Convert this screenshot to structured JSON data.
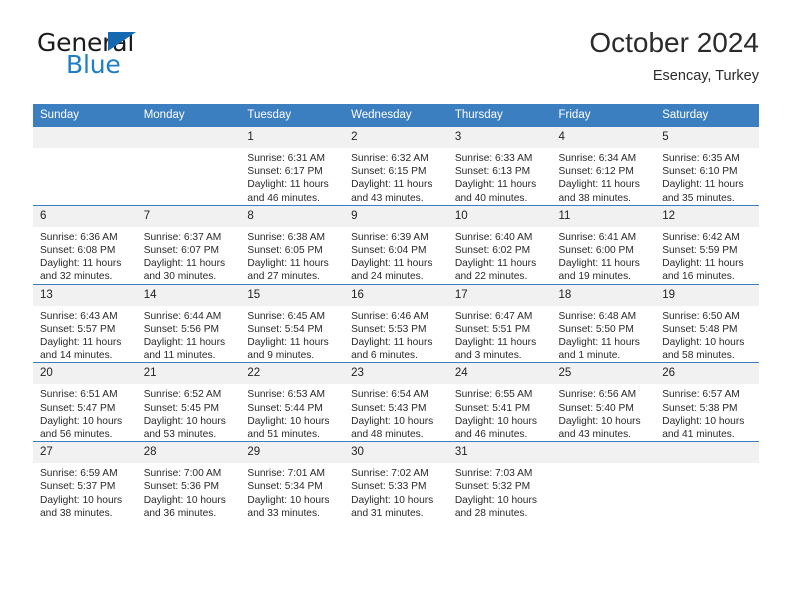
{
  "brand": {
    "name_part1": "General",
    "name_part2": "Blue",
    "triangle_color": "#1569b0",
    "blue_color": "#1f7ec4"
  },
  "header": {
    "title": "October 2024",
    "location": "Esencay, Turkey"
  },
  "theme": {
    "header_blue": "#3c7fc1",
    "daynum_band": "#f1f1f1",
    "text": "#222222"
  },
  "weekdays": [
    "Sunday",
    "Monday",
    "Tuesday",
    "Wednesday",
    "Thursday",
    "Friday",
    "Saturday"
  ],
  "weeks": [
    [
      {
        "day": "",
        "blank": true
      },
      {
        "day": "",
        "blank": true
      },
      {
        "day": "1",
        "sunrise": "Sunrise: 6:31 AM",
        "sunset": "Sunset: 6:17 PM",
        "daylight1": "Daylight: 11 hours",
        "daylight2": "and 46 minutes."
      },
      {
        "day": "2",
        "sunrise": "Sunrise: 6:32 AM",
        "sunset": "Sunset: 6:15 PM",
        "daylight1": "Daylight: 11 hours",
        "daylight2": "and 43 minutes."
      },
      {
        "day": "3",
        "sunrise": "Sunrise: 6:33 AM",
        "sunset": "Sunset: 6:13 PM",
        "daylight1": "Daylight: 11 hours",
        "daylight2": "and 40 minutes."
      },
      {
        "day": "4",
        "sunrise": "Sunrise: 6:34 AM",
        "sunset": "Sunset: 6:12 PM",
        "daylight1": "Daylight: 11 hours",
        "daylight2": "and 38 minutes."
      },
      {
        "day": "5",
        "sunrise": "Sunrise: 6:35 AM",
        "sunset": "Sunset: 6:10 PM",
        "daylight1": "Daylight: 11 hours",
        "daylight2": "and 35 minutes."
      }
    ],
    [
      {
        "day": "6",
        "sunrise": "Sunrise: 6:36 AM",
        "sunset": "Sunset: 6:08 PM",
        "daylight1": "Daylight: 11 hours",
        "daylight2": "and 32 minutes."
      },
      {
        "day": "7",
        "sunrise": "Sunrise: 6:37 AM",
        "sunset": "Sunset: 6:07 PM",
        "daylight1": "Daylight: 11 hours",
        "daylight2": "and 30 minutes."
      },
      {
        "day": "8",
        "sunrise": "Sunrise: 6:38 AM",
        "sunset": "Sunset: 6:05 PM",
        "daylight1": "Daylight: 11 hours",
        "daylight2": "and 27 minutes."
      },
      {
        "day": "9",
        "sunrise": "Sunrise: 6:39 AM",
        "sunset": "Sunset: 6:04 PM",
        "daylight1": "Daylight: 11 hours",
        "daylight2": "and 24 minutes."
      },
      {
        "day": "10",
        "sunrise": "Sunrise: 6:40 AM",
        "sunset": "Sunset: 6:02 PM",
        "daylight1": "Daylight: 11 hours",
        "daylight2": "and 22 minutes."
      },
      {
        "day": "11",
        "sunrise": "Sunrise: 6:41 AM",
        "sunset": "Sunset: 6:00 PM",
        "daylight1": "Daylight: 11 hours",
        "daylight2": "and 19 minutes."
      },
      {
        "day": "12",
        "sunrise": "Sunrise: 6:42 AM",
        "sunset": "Sunset: 5:59 PM",
        "daylight1": "Daylight: 11 hours",
        "daylight2": "and 16 minutes."
      }
    ],
    [
      {
        "day": "13",
        "sunrise": "Sunrise: 6:43 AM",
        "sunset": "Sunset: 5:57 PM",
        "daylight1": "Daylight: 11 hours",
        "daylight2": "and 14 minutes."
      },
      {
        "day": "14",
        "sunrise": "Sunrise: 6:44 AM",
        "sunset": "Sunset: 5:56 PM",
        "daylight1": "Daylight: 11 hours",
        "daylight2": "and 11 minutes."
      },
      {
        "day": "15",
        "sunrise": "Sunrise: 6:45 AM",
        "sunset": "Sunset: 5:54 PM",
        "daylight1": "Daylight: 11 hours",
        "daylight2": "and 9 minutes."
      },
      {
        "day": "16",
        "sunrise": "Sunrise: 6:46 AM",
        "sunset": "Sunset: 5:53 PM",
        "daylight1": "Daylight: 11 hours",
        "daylight2": "and 6 minutes."
      },
      {
        "day": "17",
        "sunrise": "Sunrise: 6:47 AM",
        "sunset": "Sunset: 5:51 PM",
        "daylight1": "Daylight: 11 hours",
        "daylight2": "and 3 minutes."
      },
      {
        "day": "18",
        "sunrise": "Sunrise: 6:48 AM",
        "sunset": "Sunset: 5:50 PM",
        "daylight1": "Daylight: 11 hours",
        "daylight2": "and 1 minute."
      },
      {
        "day": "19",
        "sunrise": "Sunrise: 6:50 AM",
        "sunset": "Sunset: 5:48 PM",
        "daylight1": "Daylight: 10 hours",
        "daylight2": "and 58 minutes."
      }
    ],
    [
      {
        "day": "20",
        "sunrise": "Sunrise: 6:51 AM",
        "sunset": "Sunset: 5:47 PM",
        "daylight1": "Daylight: 10 hours",
        "daylight2": "and 56 minutes."
      },
      {
        "day": "21",
        "sunrise": "Sunrise: 6:52 AM",
        "sunset": "Sunset: 5:45 PM",
        "daylight1": "Daylight: 10 hours",
        "daylight2": "and 53 minutes."
      },
      {
        "day": "22",
        "sunrise": "Sunrise: 6:53 AM",
        "sunset": "Sunset: 5:44 PM",
        "daylight1": "Daylight: 10 hours",
        "daylight2": "and 51 minutes."
      },
      {
        "day": "23",
        "sunrise": "Sunrise: 6:54 AM",
        "sunset": "Sunset: 5:43 PM",
        "daylight1": "Daylight: 10 hours",
        "daylight2": "and 48 minutes."
      },
      {
        "day": "24",
        "sunrise": "Sunrise: 6:55 AM",
        "sunset": "Sunset: 5:41 PM",
        "daylight1": "Daylight: 10 hours",
        "daylight2": "and 46 minutes."
      },
      {
        "day": "25",
        "sunrise": "Sunrise: 6:56 AM",
        "sunset": "Sunset: 5:40 PM",
        "daylight1": "Daylight: 10 hours",
        "daylight2": "and 43 minutes."
      },
      {
        "day": "26",
        "sunrise": "Sunrise: 6:57 AM",
        "sunset": "Sunset: 5:38 PM",
        "daylight1": "Daylight: 10 hours",
        "daylight2": "and 41 minutes."
      }
    ],
    [
      {
        "day": "27",
        "sunrise": "Sunrise: 6:59 AM",
        "sunset": "Sunset: 5:37 PM",
        "daylight1": "Daylight: 10 hours",
        "daylight2": "and 38 minutes."
      },
      {
        "day": "28",
        "sunrise": "Sunrise: 7:00 AM",
        "sunset": "Sunset: 5:36 PM",
        "daylight1": "Daylight: 10 hours",
        "daylight2": "and 36 minutes."
      },
      {
        "day": "29",
        "sunrise": "Sunrise: 7:01 AM",
        "sunset": "Sunset: 5:34 PM",
        "daylight1": "Daylight: 10 hours",
        "daylight2": "and 33 minutes."
      },
      {
        "day": "30",
        "sunrise": "Sunrise: 7:02 AM",
        "sunset": "Sunset: 5:33 PM",
        "daylight1": "Daylight: 10 hours",
        "daylight2": "and 31 minutes."
      },
      {
        "day": "31",
        "sunrise": "Sunrise: 7:03 AM",
        "sunset": "Sunset: 5:32 PM",
        "daylight1": "Daylight: 10 hours",
        "daylight2": "and 28 minutes."
      },
      {
        "day": "",
        "blank": true
      },
      {
        "day": "",
        "blank": true
      }
    ]
  ]
}
